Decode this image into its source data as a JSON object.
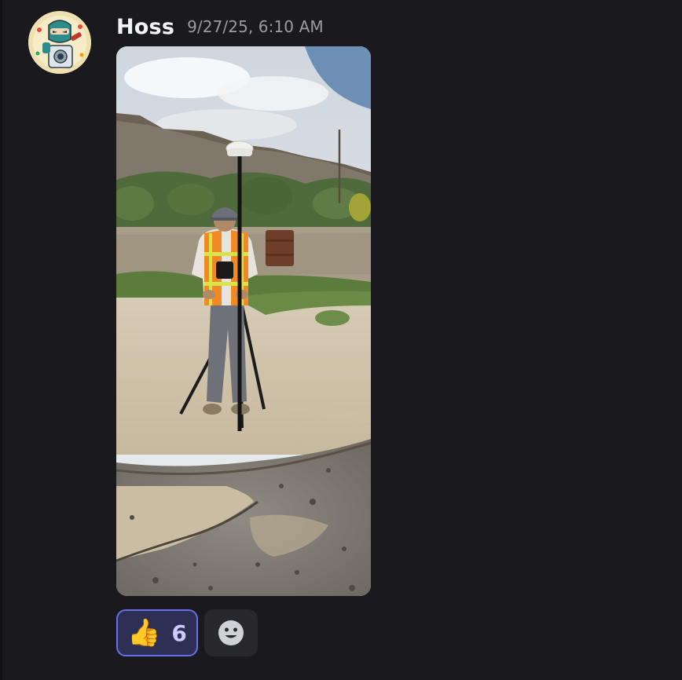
{
  "message": {
    "author": "Hoss",
    "timestamp": "9/27/25, 6:10 AM",
    "avatar_icon": "ninja-mascot-avatar",
    "attachment": {
      "type": "image",
      "subject": "surveyor-with-gps-rover-on-tripod"
    },
    "reactions": [
      {
        "emoji": "👍",
        "icon": "thumbs-up-emoji",
        "count": "6",
        "selected": true
      },
      {
        "icon": "add-reaction-smiley-icon"
      }
    ]
  },
  "colors": {
    "background": "#1a1a1e",
    "username": "#f2f3f5",
    "timestamp": "#9a9ba3",
    "reaction_active_bg": "#2d2f55",
    "reaction_active_border": "#6670e8",
    "reaction_count": "#c9cdfb"
  }
}
